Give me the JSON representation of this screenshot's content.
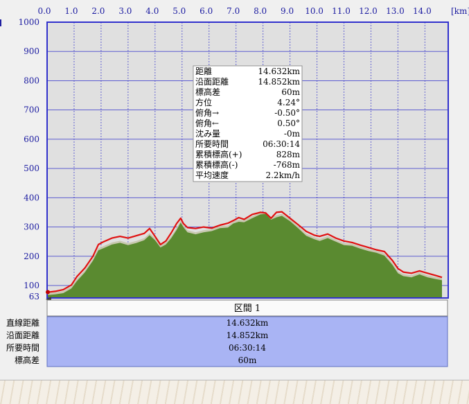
{
  "chart_data": {
    "type": "area",
    "title": "",
    "xlabel": "",
    "ylabel": "",
    "x_unit": "[km]",
    "x_ticks": [
      "0.0",
      "1.0",
      "2.0",
      "3.0",
      "4.0",
      "5.0",
      "6.0",
      "7.0",
      "8.0",
      "9.0",
      "10.0",
      "11.0",
      "12.0",
      "13.0",
      "14.0"
    ],
    "y_ticks": [
      "1000",
      "900",
      "800",
      "700",
      "600",
      "500",
      "400",
      "300",
      "200",
      "100",
      "63"
    ],
    "xlim": [
      0,
      14.632
    ],
    "ylim": [
      63,
      1000
    ],
    "grid": true,
    "colors": {
      "plot_bg": "#e0e0e0",
      "frame": "#3030cc",
      "grid": "#3030cc",
      "fill": "#5a8a30",
      "fill_edge": "#c8c8b0",
      "line": "#e01010",
      "axis_text": "#1a1aa0"
    },
    "series": [
      {
        "name": "",
        "x": [
          0,
          0.1,
          0.3,
          0.6,
          0.9,
          1.1,
          1.4,
          1.7,
          1.9,
          2.1,
          2.4,
          2.7,
          3.0,
          3.3,
          3.6,
          3.8,
          4.0,
          4.2,
          4.4,
          4.6,
          4.8,
          4.95,
          5.05,
          5.2,
          5.5,
          5.8,
          6.1,
          6.4,
          6.7,
          6.9,
          7.1,
          7.3,
          7.6,
          7.9,
          8.1,
          8.3,
          8.5,
          8.7,
          9.0,
          9.3,
          9.6,
          9.9,
          10.1,
          10.4,
          10.7,
          11.0,
          11.3,
          11.6,
          11.9,
          12.2,
          12.5,
          12.8,
          13.0,
          13.2,
          13.5,
          13.8,
          14.1,
          14.4,
          14.632
        ],
        "ground": [
          68,
          68,
          70,
          74,
          90,
          115,
          145,
          185,
          220,
          228,
          240,
          246,
          238,
          245,
          255,
          272,
          255,
          230,
          240,
          262,
          290,
          315,
          300,
          282,
          275,
          282,
          286,
          296,
          298,
          312,
          318,
          316,
          330,
          343,
          345,
          325,
          333,
          338,
          320,
          296,
          270,
          258,
          252,
          262,
          250,
          238,
          236,
          226,
          218,
          212,
          202,
          170,
          142,
          132,
          128,
          138,
          128,
          122,
          118
        ],
        "elevation": [
          80,
          78,
          80,
          86,
          102,
          130,
          160,
          200,
          240,
          250,
          262,
          268,
          262,
          270,
          278,
          295,
          268,
          240,
          252,
          280,
          312,
          330,
          312,
          298,
          295,
          300,
          296,
          306,
          313,
          322,
          332,
          326,
          343,
          350,
          348,
          330,
          350,
          352,
          330,
          308,
          285,
          272,
          268,
          276,
          262,
          252,
          247,
          238,
          230,
          222,
          216,
          185,
          158,
          146,
          142,
          150,
          142,
          134,
          128
        ]
      }
    ],
    "info_box": [
      {
        "label": "距離",
        "value": "14.632km"
      },
      {
        "label": "沿面距離",
        "value": "14.852km"
      },
      {
        "label": "標高差",
        "value": "60m"
      },
      {
        "label": "方位",
        "value": "4.24°"
      },
      {
        "label": "俯角→",
        "value": "-0.50°"
      },
      {
        "label": "俯角←",
        "value": "0.50°"
      },
      {
        "label": "沈み量",
        "value": "-0m"
      },
      {
        "label": "所要時間",
        "value": "06:30:14"
      },
      {
        "label": "累積標高(+)",
        "value": "828m"
      },
      {
        "label": "累積標高(-)",
        "value": "-768m"
      },
      {
        "label": "平均速度",
        "value": "2.2km/h"
      }
    ],
    "segment_table": {
      "header": "区間 1",
      "rows": [
        {
          "label": "直線距離",
          "value": "14.632km"
        },
        {
          "label": "沿面距離",
          "value": "14.852km"
        },
        {
          "label": "所要時間",
          "value": "06:30:14"
        },
        {
          "label": "標高差",
          "value": "60m"
        }
      ]
    }
  }
}
